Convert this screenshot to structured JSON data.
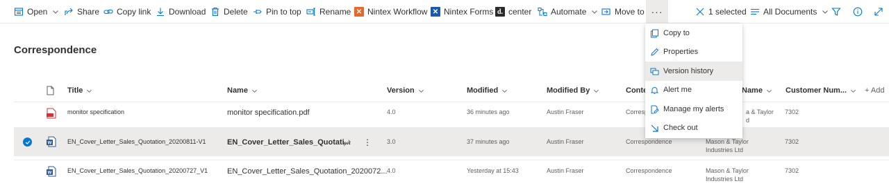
{
  "toolbar": {
    "open": "Open",
    "share": "Share",
    "copy_link": "Copy link",
    "download": "Download",
    "delete": "Delete",
    "pin_to_top": "Pin to top",
    "rename": "Rename",
    "nintex_workflow": "Nintex Workflow",
    "nintex_forms": "Nintex Forms",
    "center": "center",
    "automate": "Automate",
    "move_to": "Move to",
    "more": "···",
    "selected_count": "1 selected",
    "view": "All Documents"
  },
  "page_title": "Correspondence",
  "columns": {
    "title": "Title",
    "name": "Name",
    "version": "Version",
    "modified": "Modified",
    "modified_by": "Modified By",
    "content_type": "Conte",
    "company_name": "Name",
    "customer_number": "Customer Num...",
    "add_column": "+ Add"
  },
  "rows": [
    {
      "title": "monitor specification",
      "name": "monitor specification.pdf",
      "version": "4.0",
      "modified": "36 minutes ago",
      "modified_by": "Austin Fraser",
      "content_type": "Corresp",
      "company_line1": "a & Taylor",
      "company_line2": "d",
      "customer_number": "7302"
    },
    {
      "title": "EN_Cover_Letter_Sales_Quotation_20200811-V1",
      "name": "EN_Cover_Letter_Sales_Quotati...",
      "version": "3.0",
      "modified": "37 minutes ago",
      "modified_by": "Austin Fraser",
      "content_type": "Correspondence",
      "company_line1": "Mason & Taylor",
      "company_line2": "Industries Ltd",
      "customer_number": "7302"
    },
    {
      "title": "EN_Cover_Letter_Sales_Quotation_20200727_V1",
      "name": "EN_Cover_Letter_Sales_Quotation_2020072...",
      "version": "4.0",
      "modified": "Yesterday at 15:43",
      "modified_by": "Austin Fraser",
      "content_type": "Correspondence",
      "company_line1": "Mason & Taylor",
      "company_line2": "Industries Ltd",
      "customer_number": "7302"
    }
  ],
  "menu": {
    "items": [
      {
        "label": "Copy to"
      },
      {
        "label": "Properties"
      },
      {
        "label": "Version history"
      },
      {
        "label": "Alert me"
      },
      {
        "label": "Manage my alerts"
      },
      {
        "label": "Check out"
      }
    ]
  },
  "colors": {
    "accent": "#0078d4",
    "selected_row": "#edebe9",
    "nintex_orange": "#e8682a",
    "nintex_blue": "#1a5ba8"
  }
}
